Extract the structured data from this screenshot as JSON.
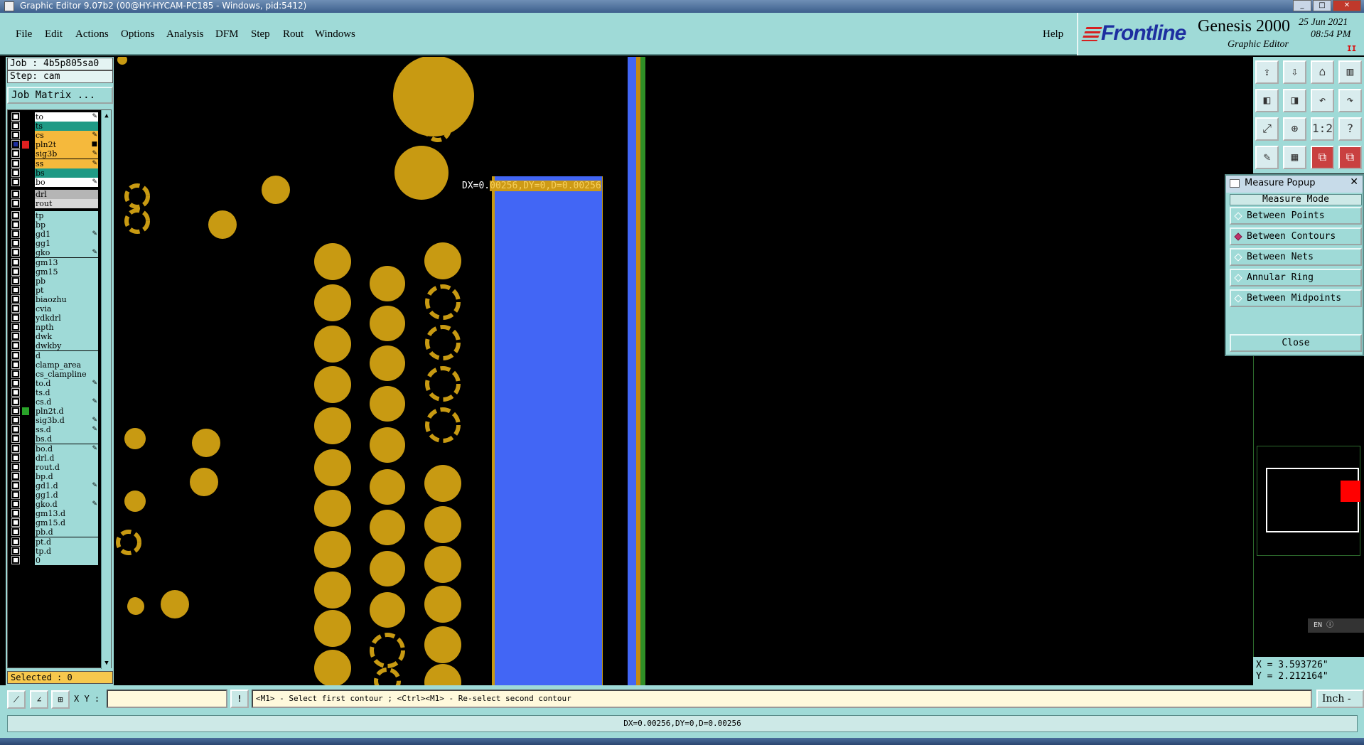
{
  "window": {
    "title": "Graphic Editor 9.07b2 (00@HY-HYCAM-PC185 - Windows, pid:5412)",
    "buttons": [
      "_",
      "□",
      "✕"
    ]
  },
  "menu": {
    "items": [
      "File",
      "Edit",
      "Actions",
      "Options",
      "Analysis",
      "DFM",
      "Step",
      "Rout",
      "Windows"
    ],
    "help": "Help"
  },
  "brand": {
    "logo": "Frontline",
    "product": "Genesis 2000",
    "subtitle": "Graphic Editor",
    "date": "25 Jun 2021",
    "time": "08:54 PM",
    "pause": "II"
  },
  "job": {
    "job_label": "Job : 4b5p805sa0",
    "step_label": "Step: cam",
    "matrix_button": "Job Matrix ..."
  },
  "layers": [
    {
      "name": "to",
      "bg": "#ffffff",
      "flag": "✎",
      "swatch": ""
    },
    {
      "name": "ts",
      "bg": "#1f9a85",
      "flag": "",
      "swatch": ""
    },
    {
      "name": "cs",
      "bg": "#f5b93c",
      "flag": "✎",
      "swatch": ""
    },
    {
      "name": "pln2t",
      "bg": "#f5b93c",
      "flag": "■",
      "swatch": "#e02020",
      "checked": true
    },
    {
      "name": "sig3b",
      "bg": "#f5b93c",
      "flag": "✎",
      "swatch": ""
    },
    {
      "name": "ss",
      "bg": "#f5b93c",
      "flag": "✎",
      "swatch": ""
    },
    {
      "name": "bs",
      "bg": "#1f9a85",
      "flag": "",
      "swatch": ""
    },
    {
      "name": "bo",
      "bg": "#ffffff",
      "flag": "✎",
      "swatch": ""
    },
    {
      "name": "drl",
      "bg": "#b5b5b5",
      "flag": "",
      "swatch": ""
    },
    {
      "name": "rout",
      "bg": "#d8d8d8",
      "flag": "",
      "swatch": ""
    },
    {
      "name": "tp",
      "bg": "#9fdad7",
      "flag": "",
      "swatch": ""
    },
    {
      "name": "bp",
      "bg": "#9fdad7",
      "flag": "",
      "swatch": ""
    },
    {
      "name": "gd1",
      "bg": "#9fdad7",
      "flag": "✎",
      "swatch": ""
    },
    {
      "name": "gg1",
      "bg": "#9fdad7",
      "flag": "",
      "swatch": ""
    },
    {
      "name": "gko",
      "bg": "#9fdad7",
      "flag": "✎",
      "swatch": ""
    },
    {
      "name": "gm13",
      "bg": "#9fdad7",
      "flag": "",
      "swatch": ""
    },
    {
      "name": "gm15",
      "bg": "#9fdad7",
      "flag": "",
      "swatch": ""
    },
    {
      "name": "pb",
      "bg": "#9fdad7",
      "flag": "",
      "swatch": ""
    },
    {
      "name": "pt",
      "bg": "#9fdad7",
      "flag": "",
      "swatch": ""
    },
    {
      "name": "biaozhu",
      "bg": "#9fdad7",
      "flag": "",
      "swatch": ""
    },
    {
      "name": "cvia",
      "bg": "#9fdad7",
      "flag": "",
      "swatch": ""
    },
    {
      "name": "ydkdrl",
      "bg": "#9fdad7",
      "flag": "",
      "swatch": ""
    },
    {
      "name": "npth",
      "bg": "#9fdad7",
      "flag": "",
      "swatch": ""
    },
    {
      "name": "dwk",
      "bg": "#9fdad7",
      "flag": "",
      "swatch": ""
    },
    {
      "name": "dwkby",
      "bg": "#9fdad7",
      "flag": "",
      "swatch": ""
    },
    {
      "name": "d",
      "bg": "#9fdad7",
      "flag": "",
      "swatch": ""
    },
    {
      "name": "clamp_area",
      "bg": "#9fdad7",
      "flag": "",
      "swatch": ""
    },
    {
      "name": "cs_clampline",
      "bg": "#9fdad7",
      "flag": "",
      "swatch": ""
    },
    {
      "name": "to.d",
      "bg": "#9fdad7",
      "flag": "✎",
      "swatch": ""
    },
    {
      "name": "ts.d",
      "bg": "#9fdad7",
      "flag": "",
      "swatch": ""
    },
    {
      "name": "cs.d",
      "bg": "#9fdad7",
      "flag": "✎",
      "swatch": ""
    },
    {
      "name": "pln2t.d",
      "bg": "#9fdad7",
      "flag": "",
      "swatch": "#29a329"
    },
    {
      "name": "sig3b.d",
      "bg": "#9fdad7",
      "flag": "✎",
      "swatch": ""
    },
    {
      "name": "ss.d",
      "bg": "#9fdad7",
      "flag": "✎",
      "swatch": ""
    },
    {
      "name": "bs.d",
      "bg": "#9fdad7",
      "flag": "",
      "swatch": ""
    },
    {
      "name": "bo.d",
      "bg": "#9fdad7",
      "flag": "✎",
      "swatch": ""
    },
    {
      "name": "drl.d",
      "bg": "#9fdad7",
      "flag": "",
      "swatch": ""
    },
    {
      "name": "rout.d",
      "bg": "#9fdad7",
      "flag": "",
      "swatch": ""
    },
    {
      "name": "bp.d",
      "bg": "#9fdad7",
      "flag": "",
      "swatch": ""
    },
    {
      "name": "gd1.d",
      "bg": "#9fdad7",
      "flag": "✎",
      "swatch": ""
    },
    {
      "name": "gg1.d",
      "bg": "#9fdad7",
      "flag": "",
      "swatch": ""
    },
    {
      "name": "gko.d",
      "bg": "#9fdad7",
      "flag": "✎",
      "swatch": ""
    },
    {
      "name": "gm13.d",
      "bg": "#9fdad7",
      "flag": "",
      "swatch": ""
    },
    {
      "name": "gm15.d",
      "bg": "#9fdad7",
      "flag": "",
      "swatch": ""
    },
    {
      "name": "pb.d",
      "bg": "#9fdad7",
      "flag": "",
      "swatch": ""
    },
    {
      "name": "pt.d",
      "bg": "#9fdad7",
      "flag": "",
      "swatch": ""
    },
    {
      "name": "tp.d",
      "bg": "#9fdad7",
      "flag": "",
      "swatch": ""
    },
    {
      "name": "0",
      "bg": "#9fdad7",
      "flag": "",
      "swatch": ""
    }
  ],
  "selected_label": "Selected : 0",
  "canvas": {
    "measure_prefix": "DX=0.",
    "measure_highlight": "00256,DY=0,D=0.00256",
    "colors": {
      "pad": "#c89a12",
      "surface": "#4266f5",
      "line_green": "#2f8f26",
      "line_orange": "#c48a14"
    }
  },
  "tools": {
    "icons": [
      "layer-up-icon",
      "layer-down-icon",
      "home-icon",
      "split-icon",
      "left-arrow-icon",
      "right-arrow-icon",
      "undo-icon",
      "redo-icon",
      "fit-icon",
      "zoom-icon",
      "one-to-two-icon",
      "help-icon",
      "brush-icon",
      "grid-icon",
      "snap-icon",
      "snap2-icon"
    ],
    "glyphs": [
      "⇪",
      "⇩",
      "⌂",
      "▥",
      "◧",
      "◨",
      "↶",
      "↷",
      "⤢",
      "⊕",
      "1:2",
      "?",
      "✎",
      "▦",
      "⧉",
      "⧉"
    ]
  },
  "measure_popup": {
    "title": "Measure Popup",
    "mode_label": "Measure Mode",
    "options": [
      {
        "label": "Between Points",
        "selected": false
      },
      {
        "label": "Between Contours",
        "selected": true
      },
      {
        "label": "Between Nets",
        "selected": false
      },
      {
        "label": "Annular Ring",
        "selected": false
      },
      {
        "label": "Between Midpoints",
        "selected": false
      }
    ],
    "close": "Close"
  },
  "lang": "EN",
  "coords": {
    "x": "X = 3.593726\"",
    "y": "Y = 2.212164\""
  },
  "bottom": {
    "xy_label": "X Y :",
    "xy_value": "",
    "warn": "!",
    "prompt": "<M1> - Select first contour ; <Ctrl><M1> - Re-select second contour",
    "units": "Inch -"
  },
  "status": "DX=0.00256,DY=0,D=0.00256"
}
